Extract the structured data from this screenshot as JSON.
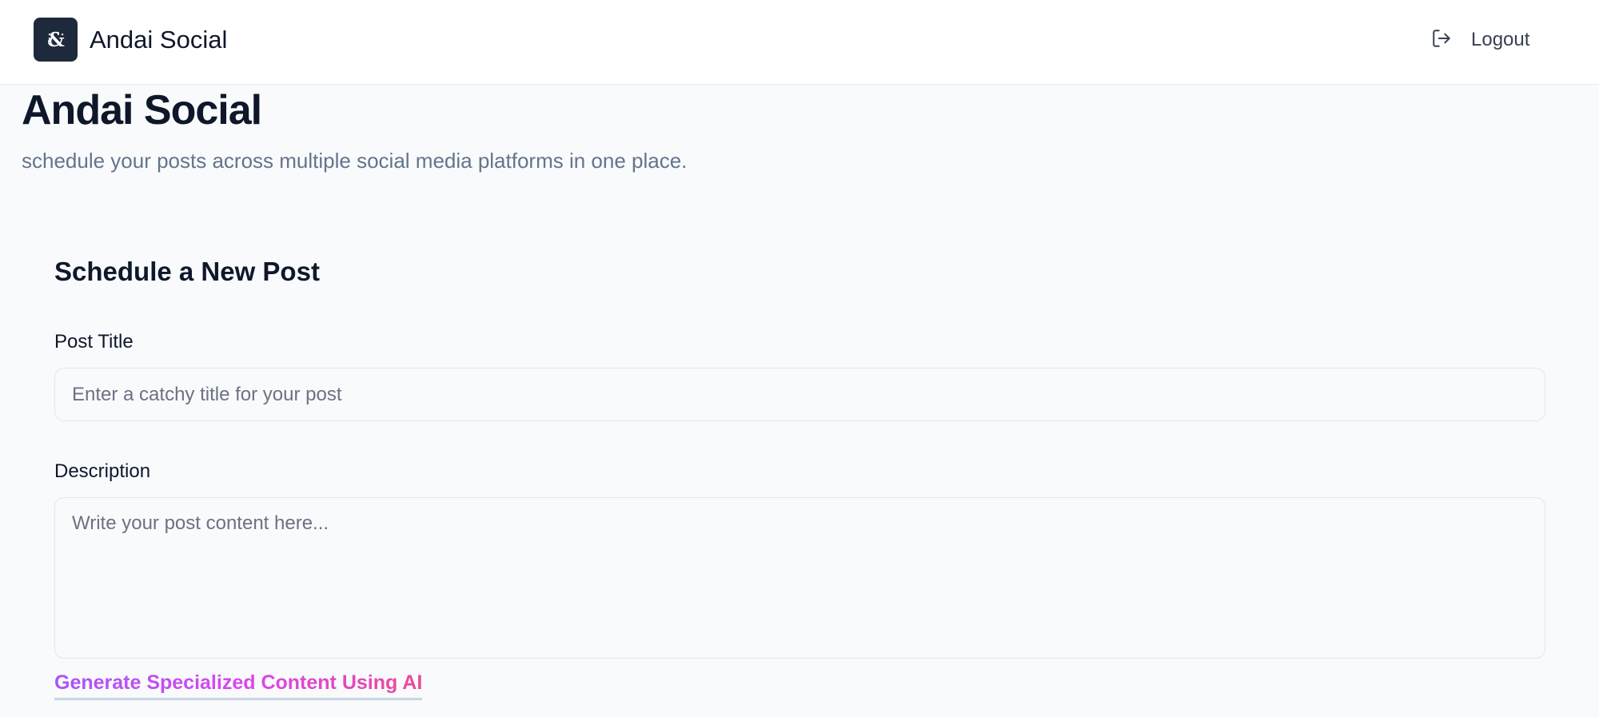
{
  "header": {
    "brand_name": "Andai Social",
    "logout_label": "Logout"
  },
  "page": {
    "title": "Andai Social",
    "subtitle": "schedule your posts across multiple social media platforms in one place."
  },
  "form": {
    "heading": "Schedule a New Post",
    "post_title_label": "Post Title",
    "post_title_placeholder": "Enter a catchy title for your post",
    "description_label": "Description",
    "description_placeholder": "Write your post content here...",
    "ai_link_label": "Generate Specialized Content Using AI"
  },
  "icons": {
    "logo": "ampersand-logo-icon",
    "logout": "logout-icon"
  },
  "colors": {
    "logo_bg": "#1e293b",
    "heading": "#0f172a",
    "muted": "#64748b",
    "ai_gradient_start": "#a855f7",
    "ai_gradient_end": "#ec4899"
  }
}
